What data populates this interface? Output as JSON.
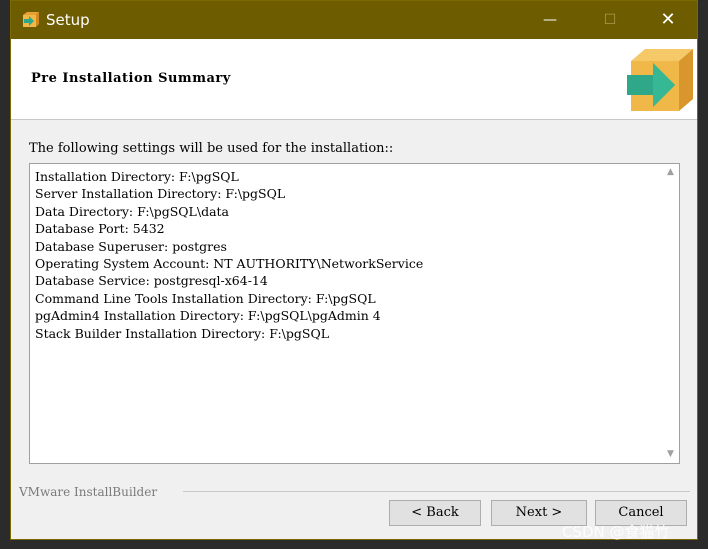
{
  "window": {
    "title": "Setup"
  },
  "titlebar": {
    "minimize_glyph": "—",
    "maximize_glyph": "☐",
    "close_glyph": "✕"
  },
  "header": {
    "title": "Pre Installation Summary"
  },
  "main": {
    "intro": "The following settings will be used for the installation::",
    "summary_lines": [
      "Installation Directory: F:\\pgSQL",
      "Server Installation Directory: F:\\pgSQL",
      "Data Directory: F:\\pgSQL\\data",
      "Database Port: 5432",
      "Database Superuser: postgres",
      "Operating System Account: NT AUTHORITY\\NetworkService",
      "Database Service: postgresql-x64-14",
      "Command Line Tools Installation Directory: F:\\pgSQL",
      "pgAdmin4 Installation Directory: F:\\pgSQL\\pgAdmin 4",
      "Stack Builder Installation Directory: F:\\pgSQL"
    ],
    "scroll_up_glyph": "▲",
    "scroll_down_glyph": "▼"
  },
  "footer": {
    "brand": "VMware InstallBuilder",
    "back_label": "< Back",
    "next_label": "Next >",
    "cancel_label": "Cancel"
  },
  "watermark": "CSDN @食猫竹",
  "colors": {
    "titlebar": "#6e5d00",
    "logo_box": "#f0b848",
    "logo_arrow": "#2fa88a"
  },
  "icons": {
    "app": "setup-box-icon",
    "logo": "box-arrow-icon"
  }
}
